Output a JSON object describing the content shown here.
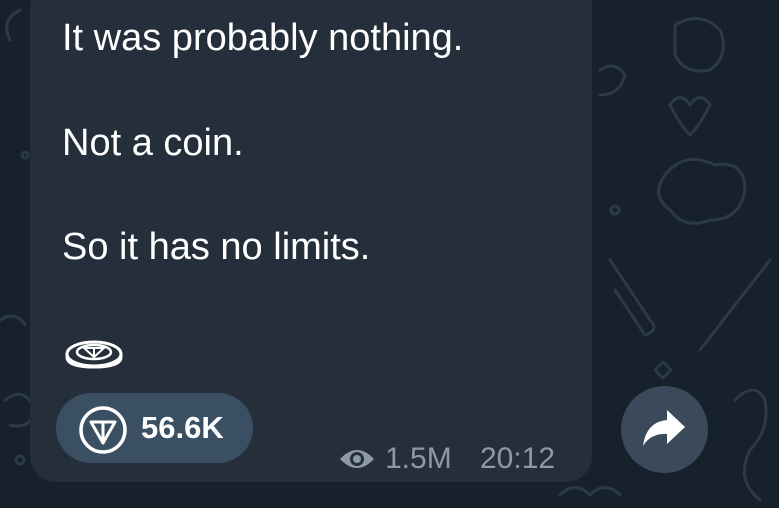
{
  "message": {
    "lines": [
      "It was probably nothing.",
      "Not a coin.",
      "So it has no limits."
    ],
    "emoji_icon": "ton-coin-icon"
  },
  "reaction": {
    "icon": "ton-logo-icon",
    "count": "56.6K"
  },
  "meta": {
    "views_icon": "eye-icon",
    "views": "1.5M",
    "time": "20:12"
  },
  "share": {
    "icon": "share-arrow-icon"
  },
  "colors": {
    "background": "#17212b",
    "bubble": "#252f3b",
    "reaction_pill": "#3b4f63",
    "meta_text": "#8d99a5",
    "share_button": "#3b4a5a"
  }
}
